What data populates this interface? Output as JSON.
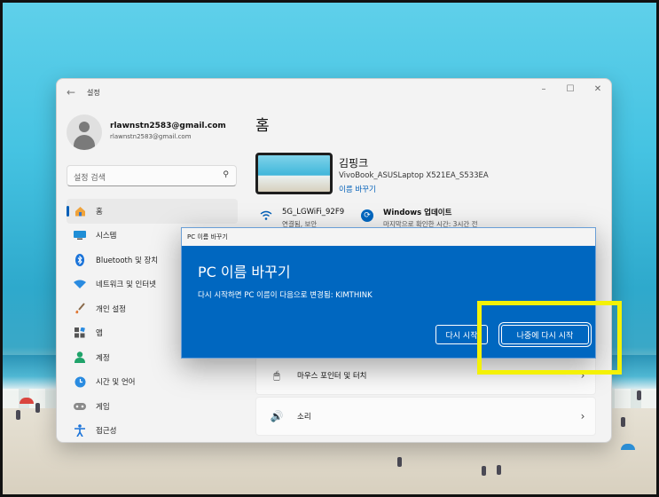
{
  "window": {
    "title": "설정",
    "controls": {
      "minimize": "–",
      "maximize": "☐",
      "close": "✕"
    },
    "back_glyph": "←"
  },
  "account": {
    "name": "rlawnstn2583@gmail.com",
    "email": "rlawnstn2583@gmail.com"
  },
  "search": {
    "placeholder": "설정 검색",
    "icon": "search-icon"
  },
  "sidebar": {
    "items": [
      {
        "label": "홈",
        "icon": "home-icon",
        "active": true
      },
      {
        "label": "시스템",
        "icon": "system-icon"
      },
      {
        "label": "Bluetooth 및 장치",
        "icon": "bluetooth-icon"
      },
      {
        "label": "네트워크 및 인터넷",
        "icon": "network-icon"
      },
      {
        "label": "개인 설정",
        "icon": "brush-icon"
      },
      {
        "label": "앱",
        "icon": "apps-icon"
      },
      {
        "label": "계정",
        "icon": "account-icon"
      },
      {
        "label": "시간 및 언어",
        "icon": "globe-icon"
      },
      {
        "label": "게임",
        "icon": "gamepad-icon"
      },
      {
        "label": "접근성",
        "icon": "accessibility-icon"
      }
    ]
  },
  "main": {
    "title": "홈",
    "device": {
      "name": "김핑크",
      "model": "VivoBook_ASUSLaptop X521EA_S533EA",
      "rename_link": "이름 바꾸기"
    },
    "wifi": {
      "name": "5G_LGWiFi_92F9",
      "status": "연결됨, 보안"
    },
    "update": {
      "name": "Windows 업데이트",
      "status": "마지막으로 확인한 시간: 3시간 전"
    },
    "rows": [
      {
        "label": "마우스 포인터 및 터치",
        "icon": "mouse-icon"
      },
      {
        "label": "소리",
        "icon": "speaker-icon"
      }
    ]
  },
  "dialog": {
    "bar_title": "PC 이름 바꾸기",
    "title": "PC 이름 바꾸기",
    "message": "다시 시작하면 PC 이름이 다음으로 변경됨: KIMTHINK",
    "restart_button": "다시 시작",
    "later_button": "나중에 다시 시작"
  },
  "colors": {
    "accent": "#005fb8",
    "dialog_bg": "#0067c0",
    "highlight": "#f4f106"
  }
}
